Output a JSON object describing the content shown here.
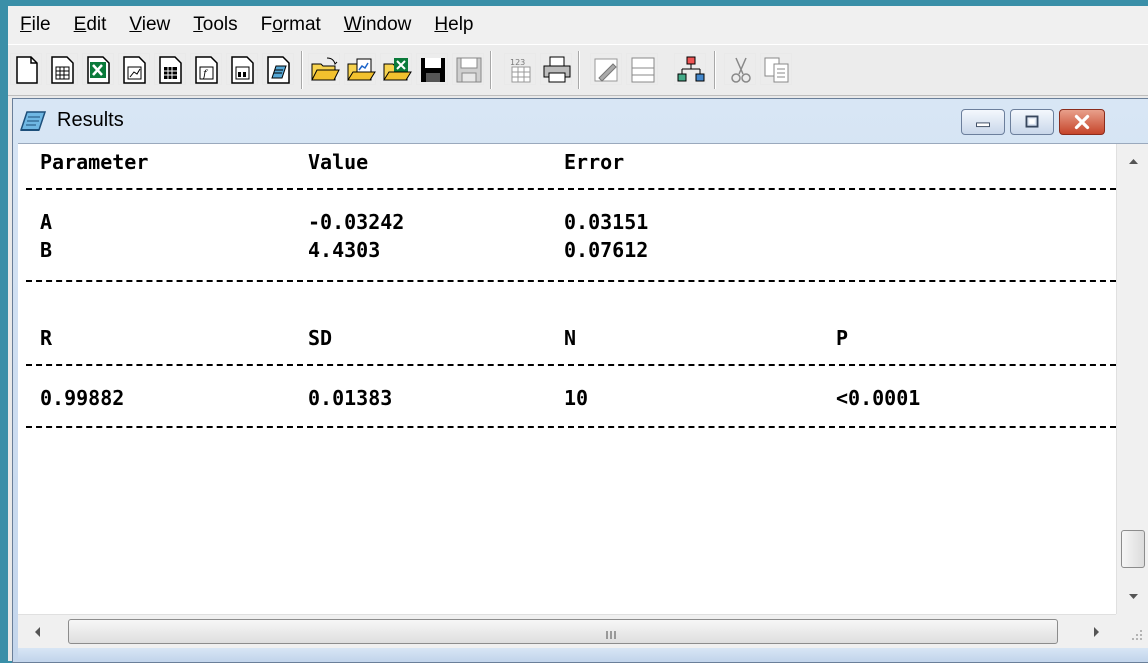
{
  "menu": {
    "file": {
      "mnemonic": "F",
      "rest": "ile"
    },
    "edit": {
      "mnemonic": "E",
      "rest": "dit"
    },
    "view": {
      "mnemonic": "V",
      "rest": "iew"
    },
    "tools": {
      "mnemonic": "T",
      "rest": "ools"
    },
    "format_pre": "F",
    "format": {
      "mnemonic": "o",
      "rest": "rmat"
    },
    "window": {
      "mnemonic": "W",
      "rest": "indow"
    },
    "help": {
      "mnemonic": "H",
      "rest": "elp"
    }
  },
  "toolbar": {
    "icons": [
      "new-document-icon",
      "new-worksheet-icon",
      "new-excel-icon",
      "new-graph-icon",
      "new-matrix-icon",
      "new-function-icon",
      "new-layout-icon",
      "new-notes-icon",
      "open-icon",
      "open-template-icon",
      "open-excel-icon",
      "save-icon",
      "save-template-icon",
      "import-icon",
      "print-icon",
      "refresh-icon",
      "duplicate-icon",
      "project-explorer-icon",
      "cut-icon",
      "copy-icon"
    ]
  },
  "results_window": {
    "title": "Results",
    "table1": {
      "headers": [
        "Parameter",
        "Value",
        "Error"
      ],
      "rows": [
        [
          "A",
          "-0.03242",
          "0.03151"
        ],
        [
          "B",
          "4.4303",
          "0.07612"
        ]
      ]
    },
    "table2": {
      "headers": [
        "R",
        "SD",
        "N",
        "P"
      ],
      "rows": [
        [
          "0.99882",
          "0.01383",
          "10",
          "<0.0001"
        ]
      ]
    }
  },
  "colors": {
    "desktop": "#3a8fa8",
    "title_gradient_top": "#d8e6f5",
    "close_button": "#c6452b"
  }
}
